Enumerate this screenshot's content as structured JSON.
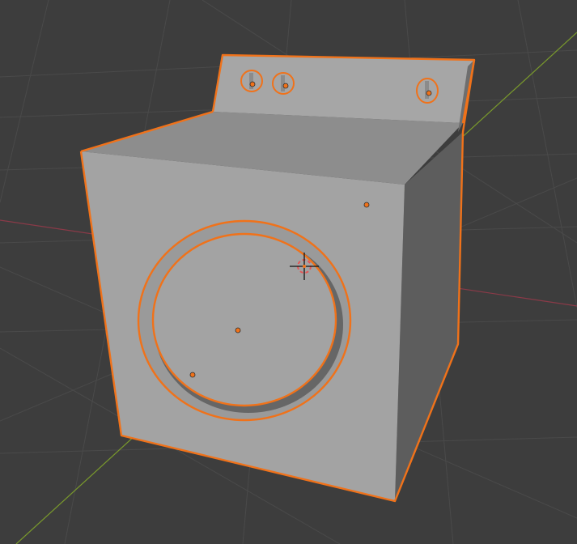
{
  "viewport": {
    "background_color": "#3d3d3d",
    "grid_color": "#4a4a4a",
    "x_axis_color": "#8a3a48",
    "y_axis_color": "#7a9a2c",
    "selection_outline_color": "#f0721a",
    "mesh_face_color": "#a3a3a3",
    "origin_dot_color": "#f0721a"
  },
  "scene": {
    "object": "washing-machine",
    "selected_parts": [
      "body",
      "control-panel",
      "knob-1",
      "knob-2",
      "knob-3",
      "door-ring",
      "door-glass"
    ],
    "cursor_icon": "3d-cursor-icon"
  }
}
